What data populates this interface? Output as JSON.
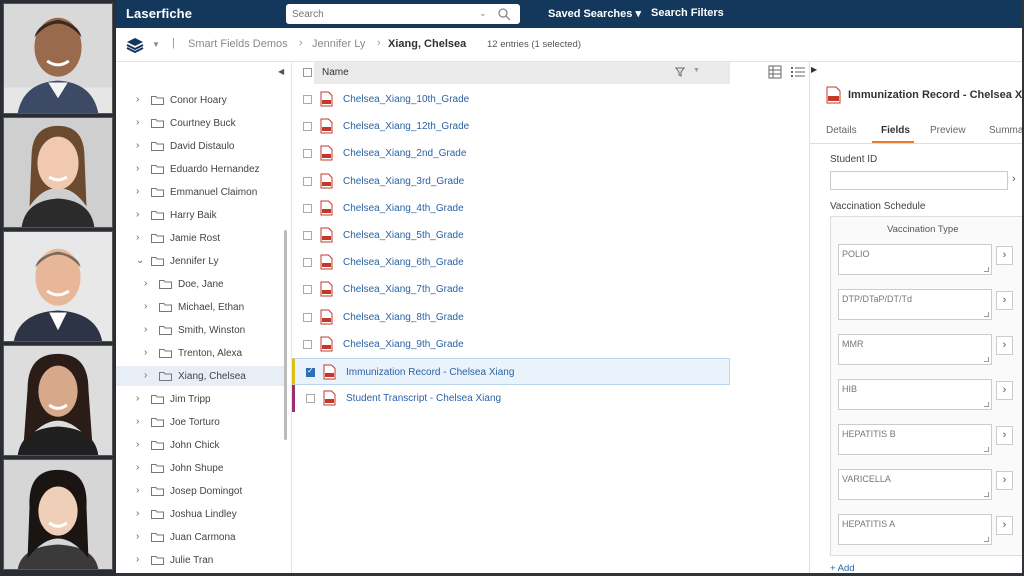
{
  "app": {
    "logo": "Laserfiche",
    "search_placeholder": "Search",
    "saved_searches": "Saved Searches",
    "saved_searches_caret": "▾",
    "search_filters": "Search Filters"
  },
  "breadcrumb": {
    "items": [
      "Smart Fields Demos",
      "Jennifer Ly",
      "Xiang, Chelsea"
    ],
    "entries_text": "12 entries (1 selected)"
  },
  "tree": {
    "items": [
      {
        "label": "Conor Hoary",
        "arrow": "›"
      },
      {
        "label": "Courtney Buck",
        "arrow": "›"
      },
      {
        "label": "David Distaulo",
        "arrow": "›"
      },
      {
        "label": "Eduardo Hernandez",
        "arrow": "›"
      },
      {
        "label": "Emmanuel Claimon",
        "arrow": "›"
      },
      {
        "label": "Harry Baik",
        "arrow": "›"
      },
      {
        "label": "Jamie Rost",
        "arrow": "›"
      },
      {
        "label": "Jennifer Ly",
        "arrow": "⌄"
      },
      {
        "label": "Doe, Jane",
        "arrow": "›"
      },
      {
        "label": "Michael, Ethan",
        "arrow": "›"
      },
      {
        "label": "Smith, Winston",
        "arrow": "›"
      },
      {
        "label": "Trenton, Alexa",
        "arrow": "›"
      },
      {
        "label": "Xiang, Chelsea",
        "arrow": "›"
      },
      {
        "label": "Jim Tripp",
        "arrow": "›"
      },
      {
        "label": "Joe Torturo",
        "arrow": "›"
      },
      {
        "label": "John Chick",
        "arrow": "›"
      },
      {
        "label": "John Shupe",
        "arrow": "›"
      },
      {
        "label": "Josep Domingot",
        "arrow": "›"
      },
      {
        "label": "Joshua Lindley",
        "arrow": "›"
      },
      {
        "label": "Juan Carmona",
        "arrow": "›"
      },
      {
        "label": "Julie Tran",
        "arrow": "›"
      }
    ]
  },
  "list": {
    "column_name": "Name",
    "rows": [
      {
        "name": "Chelsea_Xiang_10th_Grade"
      },
      {
        "name": "Chelsea_Xiang_12th_Grade"
      },
      {
        "name": "Chelsea_Xiang_2nd_Grade"
      },
      {
        "name": "Chelsea_Xiang_3rd_Grade"
      },
      {
        "name": "Chelsea_Xiang_4th_Grade"
      },
      {
        "name": "Chelsea_Xiang_5th_Grade"
      },
      {
        "name": "Chelsea_Xiang_6th_Grade"
      },
      {
        "name": "Chelsea_Xiang_7th_Grade"
      },
      {
        "name": "Chelsea_Xiang_8th_Grade"
      },
      {
        "name": "Chelsea_Xiang_9th_Grade"
      },
      {
        "name": "Immunization Record - Chelsea Xiang",
        "selected": true
      },
      {
        "name": "Student Transcript - Chelsea Xiang"
      }
    ]
  },
  "panel": {
    "title": "Immunization Record - Chelsea Xiang",
    "tabs": [
      "Details",
      "Fields",
      "Preview",
      "Summa"
    ],
    "active_tab": "Fields",
    "student_id_label": "Student ID",
    "student_id_value": "",
    "schedule_label": "Vaccination Schedule",
    "schedule_column": "Vaccination Type",
    "vaccines": [
      "POLIO",
      "DTP/DTaP/DT/Td",
      "MMR",
      "HIB",
      "HEPATITIS B",
      "VARICELLA",
      "HEPATITIS A"
    ],
    "add_link": "+ Add"
  },
  "colors": {
    "topbar": "#14385c",
    "link": "#2a63a5",
    "active_tab_underline": "#e87b2c"
  }
}
